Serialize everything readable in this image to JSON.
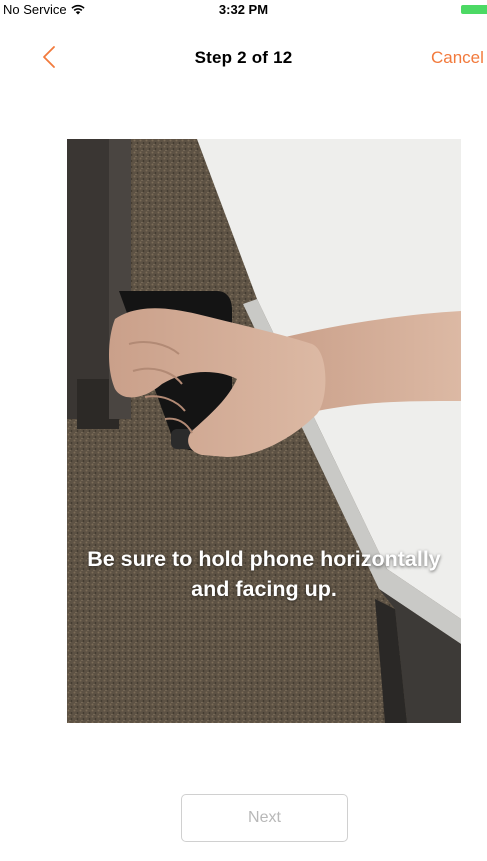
{
  "status_bar": {
    "carrier": "No Service",
    "time": "3:32 PM"
  },
  "nav": {
    "title": "Step 2 of 12",
    "cancel_label": "Cancel",
    "accent_color": "#f27a3c"
  },
  "step": {
    "instruction": "Be sure to hold phone horizontally and facing up.",
    "image_alt": "hand-holding-phone-photo"
  },
  "footer": {
    "next_label": "Next",
    "next_enabled": false
  }
}
